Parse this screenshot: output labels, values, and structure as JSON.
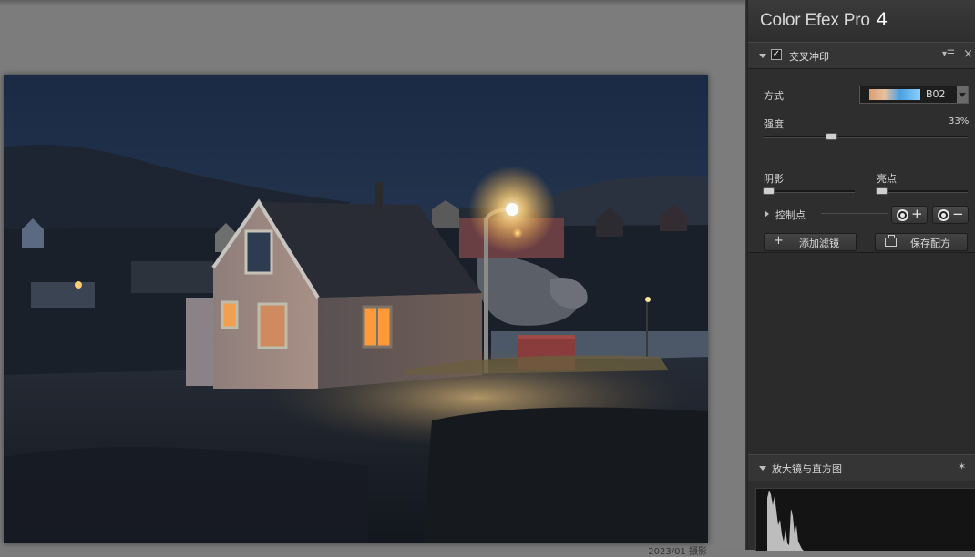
{
  "app": {
    "title": "Color Efex Pro",
    "version": "4"
  },
  "canvas": {
    "caption": "2023/01  摄影"
  },
  "filter": {
    "name": "交叉冲印",
    "enabled": true,
    "menu_icon": "▾☰",
    "close_icon": "×",
    "method_label": "方式",
    "method_value": "B02",
    "strength_label": "强度",
    "strength_value": "33%",
    "strength_fraction": 0.33,
    "shadows_label": "阴影",
    "shadows_fraction": 0.05,
    "highlights_label": "亮点",
    "highlights_fraction": 0.05,
    "control_points_label": "控制点",
    "add_point_sign": "+",
    "remove_point_sign": "−"
  },
  "actions": {
    "add_filter_icon": "+",
    "add_filter_label": "添加滤镜",
    "save_recipe_label": "保存配方"
  },
  "loupe": {
    "title": "放大镜与直方图",
    "pin_icon": "✶"
  },
  "colors": {
    "panel_bg": "#2e2e2e",
    "canvas_bg": "#7c7c7c",
    "accent_text": "#d8d8d8"
  }
}
